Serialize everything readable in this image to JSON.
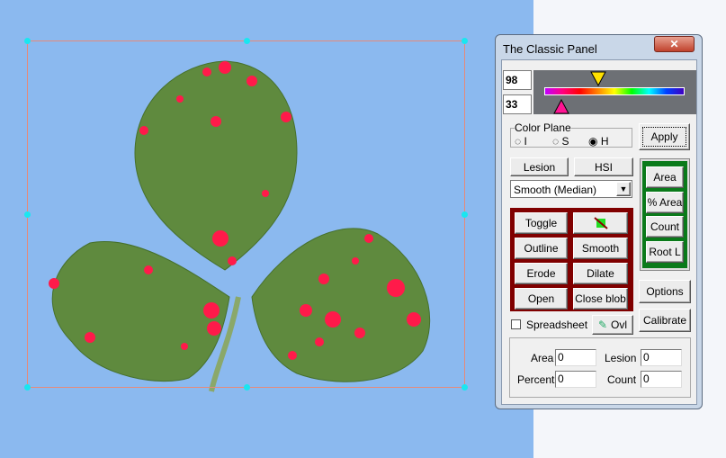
{
  "window": {
    "title": "The Classic Panel",
    "close_icon": "close-icon"
  },
  "threshold": {
    "upper": "98",
    "lower": "33",
    "upper_pointer_color": "#ffe000",
    "lower_pointer_color": "#ff1493"
  },
  "color_plane": {
    "label": "Color Plane",
    "options": [
      "I",
      "S",
      "H"
    ],
    "selected": "H"
  },
  "buttons": {
    "apply": "Apply",
    "lesion": "Lesion",
    "hsi": "HSI",
    "toggle": "Toggle",
    "outline": "Outline",
    "smooth": "Smooth",
    "erode": "Erode",
    "dilate": "Dilate",
    "open": "Open",
    "close_blob": "Close blob",
    "area": "Area",
    "pct_area": "% Area",
    "count": "Count",
    "root_l": "Root L",
    "options": "Options",
    "calibrate": "Calibrate",
    "ovl": "Ovl"
  },
  "filter_select": {
    "value": "Smooth (Median)"
  },
  "spreadsheet": {
    "label": "Spreadsheet",
    "checked": false
  },
  "results": {
    "area_label": "Area",
    "area": "0",
    "lesion_label": "Lesion",
    "lesion": "0",
    "percent_label": "Percent",
    "percent": "0",
    "count_label": "Count",
    "count": "0"
  },
  "colors": {
    "background": "#8bb9ef",
    "lesion": "#ff1a4a",
    "leaf": "#5f8a3e",
    "op_frame": "#800000",
    "measure_frame": "#0a7a1a"
  }
}
